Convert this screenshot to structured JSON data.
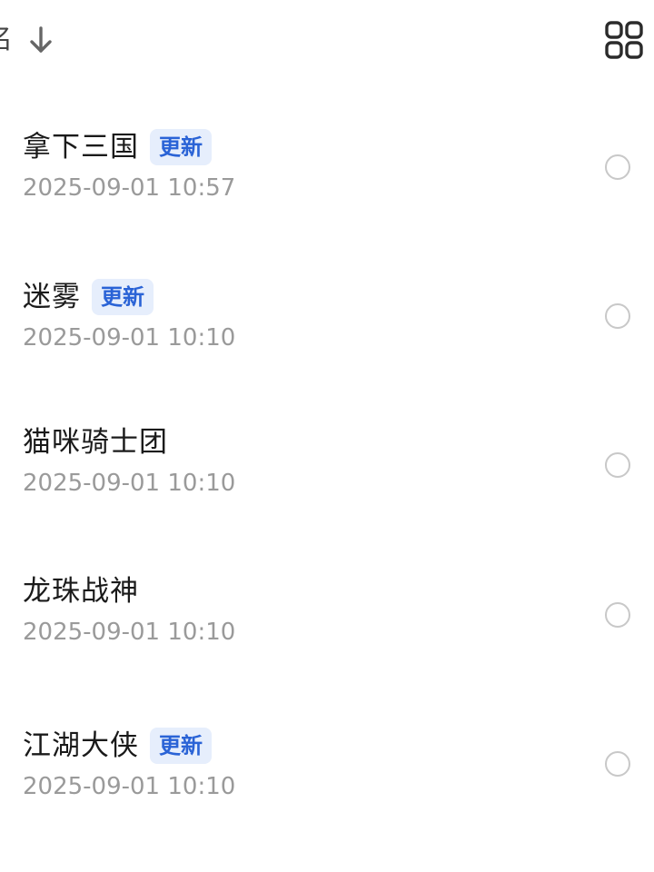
{
  "header": {
    "sort_label": "名",
    "sort_icon": "arrow-down-icon",
    "view_toggle_icon": "grid-view-icon"
  },
  "items": [
    {
      "title": "拿下三国",
      "badge": "更新",
      "time": "2025-09-01 10:57"
    },
    {
      "title": "迷雾",
      "badge": "更新",
      "time": "2025-09-01 10:10"
    },
    {
      "title": "猫咪骑士团",
      "badge": "",
      "time": "2025-09-01 10:10"
    },
    {
      "title": "龙珠战神",
      "badge": "",
      "time": "2025-09-01 10:10"
    },
    {
      "title": "江湖大侠",
      "badge": "更新",
      "time": "2025-09-01 10:10"
    }
  ],
  "colors": {
    "badge_bg": "#e6eefc",
    "badge_text": "#2a63d6",
    "timestamp": "#9a9a9a",
    "radio_border": "#c8c8c8"
  }
}
